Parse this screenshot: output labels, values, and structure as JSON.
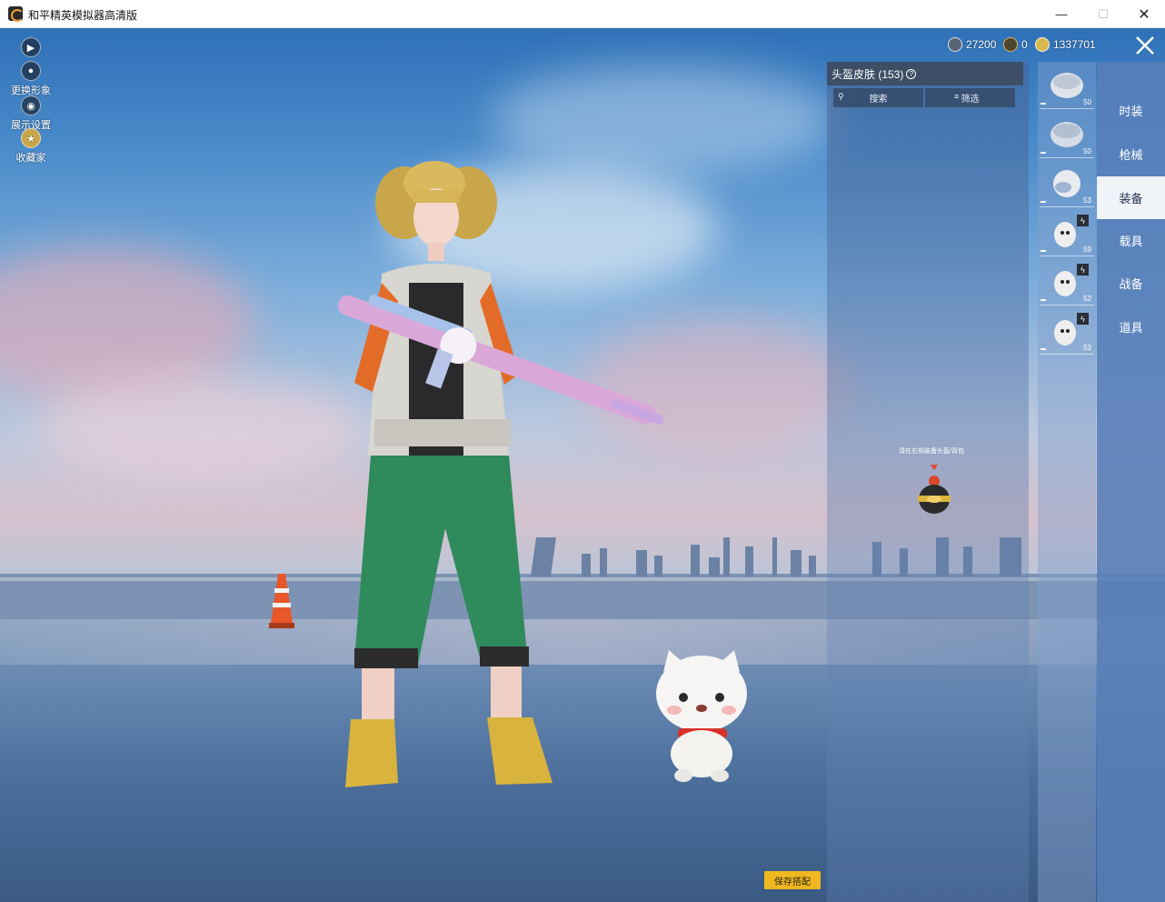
{
  "window": {
    "title": "和平精英模拟器高清版",
    "minimize_glyph": "—",
    "maximize_glyph": "☐",
    "close_glyph": "✕"
  },
  "left_tools": [
    {
      "label": "",
      "icon": "play-icon"
    },
    {
      "label": "更换形象",
      "icon": "user-icon"
    },
    {
      "label": "展示设置",
      "icon": "eye-icon"
    },
    {
      "label": "收藏家",
      "icon": "badge-icon"
    }
  ],
  "currency": [
    {
      "value": "27200",
      "icon": "silver-coin-icon"
    },
    {
      "value": "0",
      "icon": "gold-token-icon"
    },
    {
      "value": "1337701",
      "icon": "gold-coin-icon"
    }
  ],
  "panel": {
    "title": "头盔皮肤 (153)",
    "help_glyph": "?",
    "search_label": "搜索",
    "filter_label": "筛选",
    "hint": "请在右侧装备头盔/背包"
  },
  "items": [
    {
      "num": "50",
      "badge": ""
    },
    {
      "num": "50",
      "badge": ""
    },
    {
      "num": "53",
      "badge": ""
    },
    {
      "num": "59",
      "badge": "ϟ"
    },
    {
      "num": "52",
      "badge": "ϟ"
    },
    {
      "num": "53",
      "badge": "ϟ"
    }
  ],
  "tabs": [
    {
      "label": "时装",
      "active": false
    },
    {
      "label": "枪械",
      "active": false
    },
    {
      "label": "装备",
      "active": true
    },
    {
      "label": "载具",
      "active": false
    },
    {
      "label": "战备",
      "active": false
    },
    {
      "label": "道具",
      "active": false
    }
  ],
  "save_label": "保存搭配",
  "colors": {
    "tab_column": "#587eb8",
    "active_tab": "#f0f3f8",
    "save_button": "#f0b820"
  }
}
